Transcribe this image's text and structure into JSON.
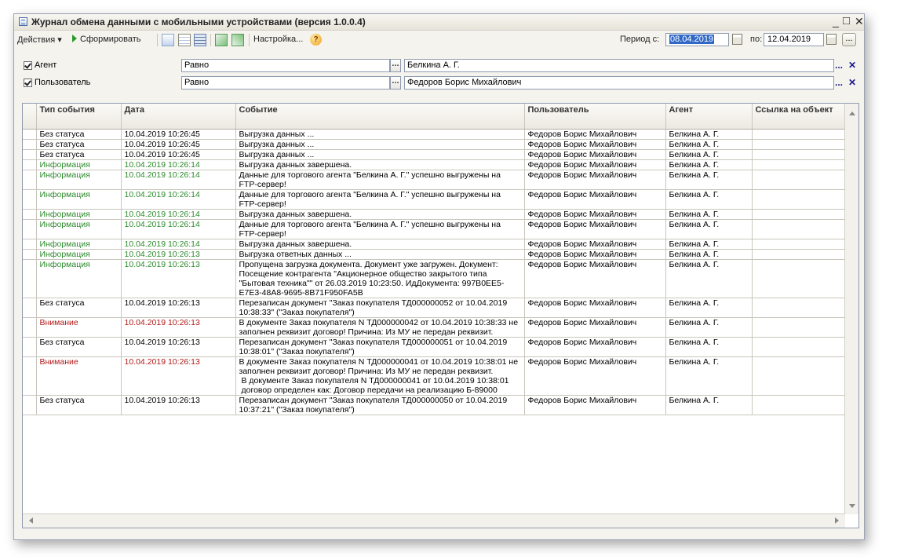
{
  "window": {
    "title": "Журнал обмена данными с мобильными устройствами (версия 1.0.0.4)",
    "minimize": "_",
    "maximize": "□",
    "close": "✕"
  },
  "toolbar": {
    "actions_label": "Действия ▾",
    "generate_label": "Сформировать",
    "settings_label": "Настройка...",
    "help": "?",
    "period_from_label": "Период с:",
    "period_from_value": "08.04.2019",
    "period_to_label": "по:",
    "period_to_value": "12.04.2019",
    "more_label": "..."
  },
  "filters": {
    "agent": {
      "label": "Агент",
      "condition": "Равно",
      "value": "Белкина А. Г."
    },
    "user": {
      "label": "Пользователь",
      "condition": "Равно",
      "value": "Федоров Борис Михайлович"
    },
    "ellipsis": "...",
    "clear": "✕"
  },
  "table": {
    "headers": [
      "Тип события",
      "Дата",
      "Событие",
      "Пользователь",
      "Агент",
      "Ссылка на объект"
    ],
    "rows": [
      {
        "type": "Без статуса",
        "date": "10.04.2019 10:26:45",
        "event": "Выгрузка данных ...",
        "user": "Федоров Борис Михайлович",
        "agent": "Белкина А. Г."
      },
      {
        "type": "Без статуса",
        "date": "10.04.2019 10:26:45",
        "event": "Выгрузка данных ...",
        "user": "Федоров Борис Михайлович",
        "agent": "Белкина А. Г."
      },
      {
        "type": "Без статуса",
        "date": "10.04.2019 10:26:45",
        "event": "Выгрузка данных ...",
        "user": "Федоров Борис Михайлович",
        "agent": "Белкина А. Г."
      },
      {
        "type": "Информация",
        "date": "10.04.2019 10:26:14",
        "event": "Выгрузка данных завершена.",
        "user": "Федоров Борис Михайлович",
        "agent": "Белкина А. Г."
      },
      {
        "type": "Информация",
        "date": "10.04.2019 10:26:14",
        "event": "Данные для торгового агента \"Белкина А. Г.\" успешно выгружены на FTP-сервер!",
        "user": "Федоров Борис Михайлович",
        "agent": "Белкина А. Г."
      },
      {
        "type": "Информация",
        "date": "10.04.2019 10:26:14",
        "event": "Данные для торгового агента \"Белкина А. Г.\" успешно выгружены на FTP-сервер!",
        "user": "Федоров Борис Михайлович",
        "agent": "Белкина А. Г."
      },
      {
        "type": "Информация",
        "date": "10.04.2019 10:26:14",
        "event": "Выгрузка данных завершена.",
        "user": "Федоров Борис Михайлович",
        "agent": "Белкина А. Г."
      },
      {
        "type": "Информация",
        "date": "10.04.2019 10:26:14",
        "event": "Данные для торгового агента \"Белкина А. Г.\" успешно выгружены на FTP-сервер!",
        "user": "Федоров Борис Михайлович",
        "agent": "Белкина А. Г."
      },
      {
        "type": "Информация",
        "date": "10.04.2019 10:26:14",
        "event": "Выгрузка данных завершена.",
        "user": "Федоров Борис Михайлович",
        "agent": "Белкина А. Г."
      },
      {
        "type": "Информация",
        "date": "10.04.2019 10:26:13",
        "event": "Выгрузка ответных данных ...",
        "user": "Федоров Борис Михайлович",
        "agent": "Белкина А. Г."
      },
      {
        "type": "Информация",
        "date": "10.04.2019 10:26:13",
        "event": "Пропущена загрузка документа. Документ уже загружен. Документ: Посещение контрагента \"Акционерное общество закрытого типа \"Бытовая техника\"\" от 26.03.2019 10:23:50. ИдДокумента: 997B0EE5-E7E3-48A8-9695-8B71F950FA5B",
        "user": "Федоров Борис Михайлович",
        "agent": "Белкина А. Г."
      },
      {
        "type": "Без статуса",
        "date": "10.04.2019 10:26:13",
        "event": "Перезаписан документ \"Заказ покупателя ТД000000052 от 10.04.2019 10:38:33\" (\"Заказ покупателя\")",
        "user": "Федоров Борис Михайлович",
        "agent": "Белкина А. Г."
      },
      {
        "type": "Внимание",
        "date": "10.04.2019 10:26:13",
        "event": "В документе Заказ покупателя N ТД000000042 от 10.04.2019 10:38:33 не заполнен реквизит договор! Причина: Из МУ не передан реквизит.",
        "user": "Федоров Борис Михайлович",
        "agent": "Белкина А. Г."
      },
      {
        "type": "Без статуса",
        "date": "10.04.2019 10:26:13",
        "event": "Перезаписан документ \"Заказ покупателя ТД000000051 от 10.04.2019 10:38:01\" (\"Заказ покупателя\")",
        "user": "Федоров Борис Михайлович",
        "agent": "Белкина А. Г."
      },
      {
        "type": "Внимание",
        "date": "10.04.2019 10:26:13",
        "event": "В документе Заказ покупателя N ТД000000041 от 10.04.2019 10:38:01 не заполнен реквизит договор! Причина: Из МУ не передан реквизит.",
        "event2": "В документе Заказ покупателя N ТД000000041 от 10.04.2019 10:38:01 договор определен как: Договор передачи на реализацию Б-89000",
        "user": "Федоров Борис Михайлович",
        "agent": "Белкина А. Г."
      },
      {
        "type": "Без статуса",
        "date": "10.04.2019 10:26:13",
        "event": "Перезаписан документ \"Заказ покупателя ТД000000050 от 10.04.2019 10:37:21\" (\"Заказ покупателя\")",
        "user": "Федоров Борис Михайлович",
        "agent": "Белкина А. Г."
      }
    ]
  },
  "colors": {
    "info": "#2b8a2b",
    "warning": "#b01818",
    "selection": "#3168c6"
  }
}
